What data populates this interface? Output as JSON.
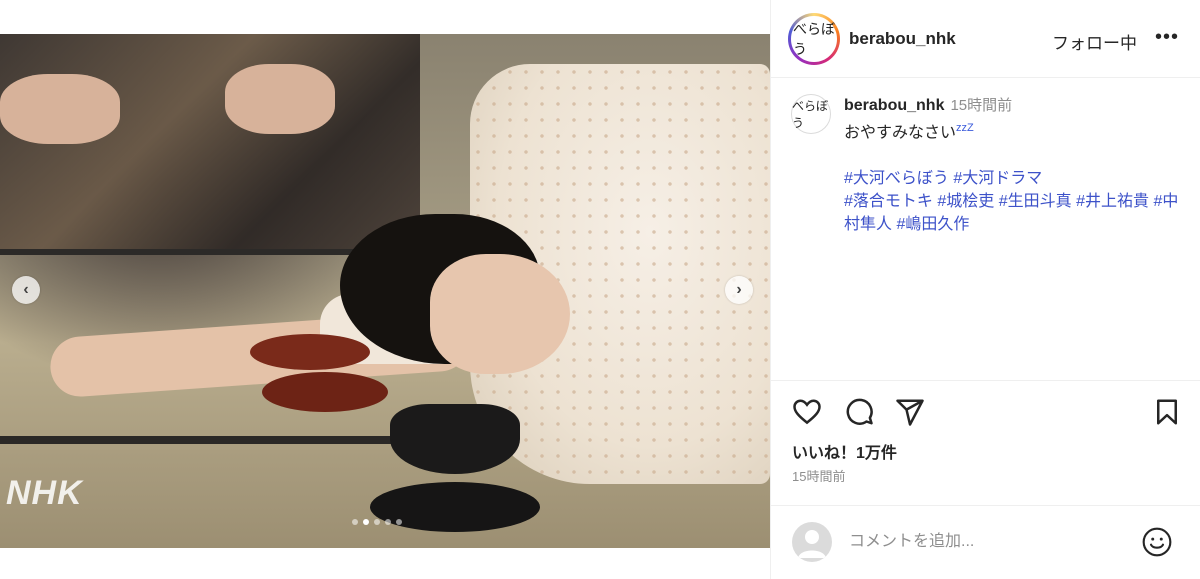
{
  "post": {
    "username": "berabou_nhk",
    "follow_status": "フォロー中",
    "more_label": "•••",
    "avatar_text": "べらぼう"
  },
  "media": {
    "watermark": "NHK",
    "prev_label": "‹",
    "next_label": "›",
    "carousel_total": 5,
    "carousel_active_index": 1
  },
  "caption": {
    "username": "berabou_nhk",
    "time_ago": "15時間前",
    "text": "おやすみなさい",
    "zzz": "zzZ",
    "hashtags": [
      "#大河べらぼう",
      "#大河ドラマ",
      "#落合モトキ",
      "#城桧吏",
      "#生田斗真",
      "#井上祐貴",
      "#中村隼人",
      "#嶋田久作"
    ]
  },
  "actions": {
    "likes": "いいね！1万件",
    "post_time": "15時間前"
  },
  "comment": {
    "placeholder": "コメントを追加..."
  },
  "colors": {
    "hashtag": "#3d52c9",
    "muted": "#8e8e8e",
    "text": "#262626"
  },
  "icons": [
    "heart-icon",
    "comment-icon",
    "share-icon",
    "bookmark-icon",
    "emoji-icon",
    "more-icon",
    "chevron-left-icon",
    "chevron-right-icon"
  ]
}
